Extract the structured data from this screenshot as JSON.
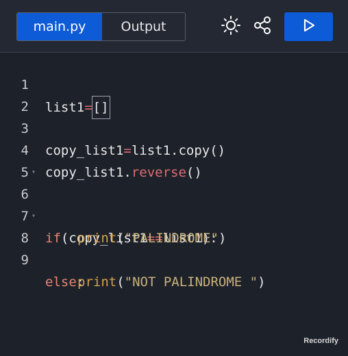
{
  "tabs": {
    "main_label": "main.py",
    "output_label": "Output"
  },
  "toolbar": {
    "theme_icon": "sun-icon",
    "share_icon": "share-icon",
    "run_icon": "play-icon"
  },
  "colors": {
    "accent": "#0d5bd6",
    "background": "#1d2129",
    "operator": "#e06c75",
    "keyword": "#e88574",
    "function": "#d7a24d",
    "string": "#c8b27c"
  },
  "editor": {
    "lines": [
      {
        "number": "1",
        "tokens": [
          "list1",
          "=",
          "[",
          "]"
        ]
      },
      {
        "number": "2",
        "tokens": []
      },
      {
        "number": "3",
        "tokens": [
          "copy_list1",
          "=",
          "list1.copy()"
        ]
      },
      {
        "number": "4",
        "tokens": [
          "copy_list1.",
          "reverse",
          "()"
        ]
      },
      {
        "number": "5",
        "tokens": []
      },
      {
        "number": "6",
        "tokens": [
          "if",
          "(copy_list1",
          "==",
          "list1):"
        ]
      },
      {
        "number": "7",
        "tokens": [
          "print",
          "(",
          "\"PALINDROME\"",
          ")"
        ]
      },
      {
        "number": "8",
        "tokens": [
          "else",
          ":"
        ]
      },
      {
        "number": "9",
        "tokens": [
          "print",
          "(",
          "\"NOT PALINDROME \"",
          ")"
        ]
      }
    ]
  },
  "watermark": "Recordify"
}
